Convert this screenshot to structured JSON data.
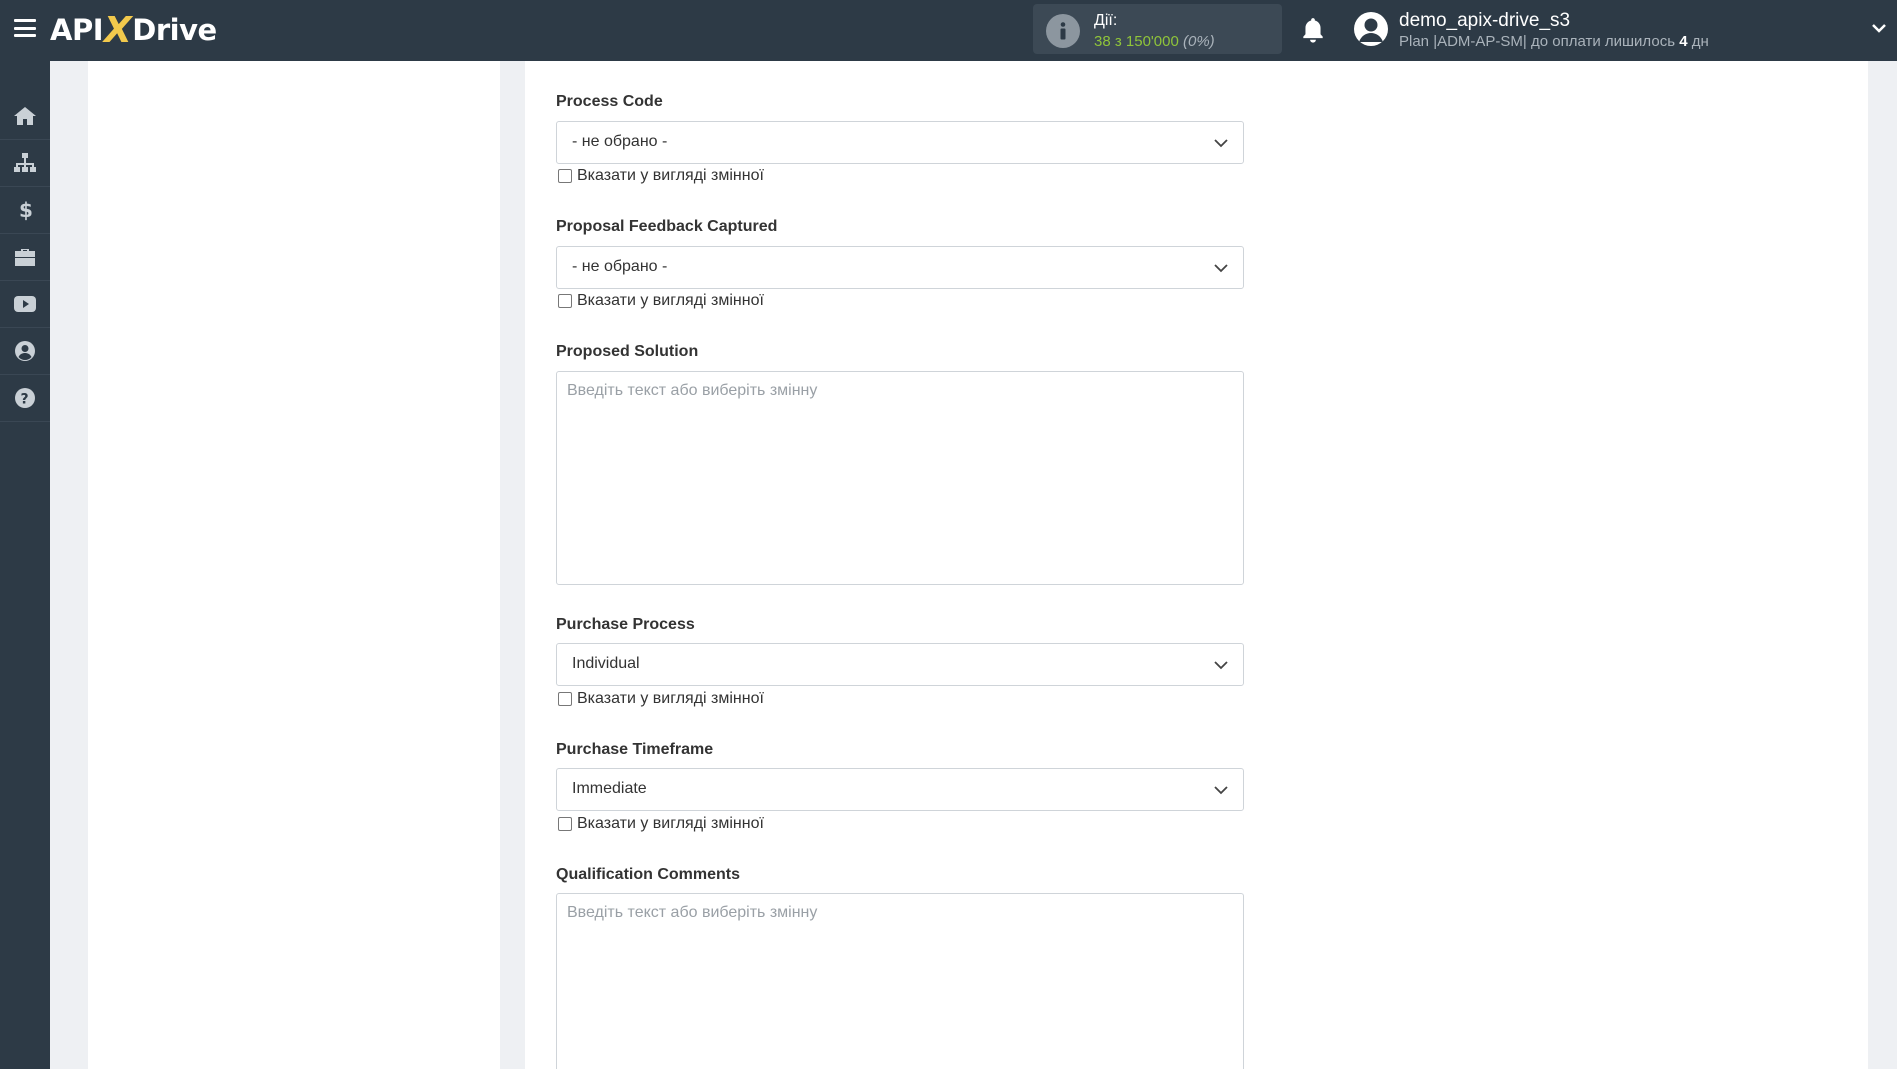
{
  "header": {
    "logo_api": "API",
    "logo_x": "X",
    "logo_drive": "Drive",
    "actions": {
      "label": "Дії:",
      "value": "38 з 150'000",
      "percent": "(0%)"
    },
    "user": {
      "name": "demo_apix-drive_s3",
      "plan_prefix": "Plan |ADM-AP-SM| до оплати лишилось ",
      "days": "4",
      "days_unit": " дн"
    }
  },
  "sidebar": {
    "items": [
      {
        "icon": "home-icon"
      },
      {
        "icon": "sitemap-icon"
      },
      {
        "icon": "dollar-icon"
      },
      {
        "icon": "briefcase-icon"
      },
      {
        "icon": "youtube-icon"
      },
      {
        "icon": "user-circle-icon"
      },
      {
        "icon": "question-icon"
      }
    ]
  },
  "form": {
    "checkbox_label": "Вказати у вигляді змінної",
    "placeholder": "Введіть текст або виберіть змінну",
    "fields": [
      {
        "label": "Process Code",
        "type": "select",
        "value": "- не обрано -"
      },
      {
        "label": "Proposal Feedback Captured",
        "type": "select",
        "value": "- не обрано -"
      },
      {
        "label": "Proposed Solution",
        "type": "textarea"
      },
      {
        "label": "Purchase Process",
        "type": "select",
        "value": "Individual"
      },
      {
        "label": "Purchase Timeframe",
        "type": "select",
        "value": "Immediate"
      },
      {
        "label": "Qualification Comments",
        "type": "textarea"
      }
    ]
  },
  "colors": {
    "topbar": "#2d3a46",
    "accent_green": "#8fc43a",
    "logo_yellow": "#f2c94c"
  }
}
